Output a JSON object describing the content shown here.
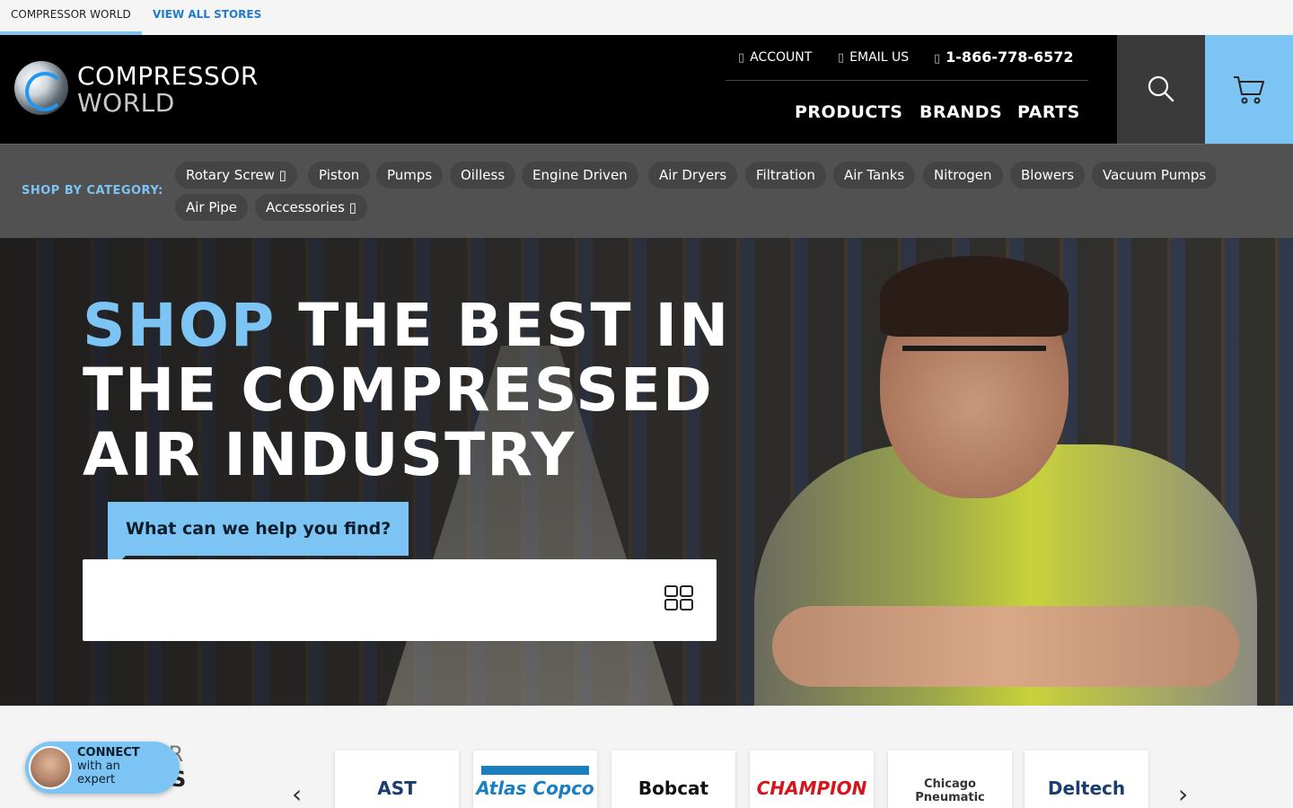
{
  "topbar": {
    "store": "COMPRESSOR WORLD",
    "view_all": "VIEW ALL STORES"
  },
  "header": {
    "logo_line1": "COMPRESSOR",
    "logo_line2": "WORLD",
    "account": "ACCOUNT",
    "email": "EMAIL US",
    "phone": "1-866-778-6572",
    "nav": [
      "PRODUCTS",
      "BRANDS",
      "PARTS"
    ]
  },
  "categories": {
    "label": "SHOP BY CATEGORY:",
    "items": [
      "Rotary Screw ▯",
      "Piston",
      "Pumps",
      "Oilless",
      "Engine Driven",
      "Air Dryers",
      "Filtration",
      "Air Tanks",
      "Nitrogen",
      "Blowers",
      "Vacuum Pumps",
      "Air Pipe",
      "Accessories ▯"
    ]
  },
  "hero": {
    "accent": "SHOP",
    "headline_rest": " THE BEST IN THE COMPRESSED AIR INDUSTRY",
    "prompt": "What can we help you find?",
    "search_placeholder": ""
  },
  "brands": {
    "title_partial": "UR",
    "title_bold_partial": "S",
    "items": [
      "AST",
      "Atlas Copco",
      "Bobcat",
      "CHAMPION",
      "Chicago Pneumatic",
      "Deltech"
    ],
    "colors": [
      "#1a3c6e",
      "#1a7fc1",
      "#111111",
      "#d4161c",
      "#d4161c",
      "#1a5fb4"
    ]
  },
  "connect": {
    "title": "CONNECT",
    "subtitle": "with an expert"
  },
  "icons": {
    "account": "user-icon",
    "email": "envelope-icon",
    "phone": "phone-icon",
    "search": "search-icon",
    "cart": "cart-icon",
    "scan": "barcode-icon"
  },
  "colors": {
    "accent": "#7cc4f4",
    "link": "#1f7ad1",
    "header_bg": "#000000",
    "catbar_bg": "#515151"
  }
}
